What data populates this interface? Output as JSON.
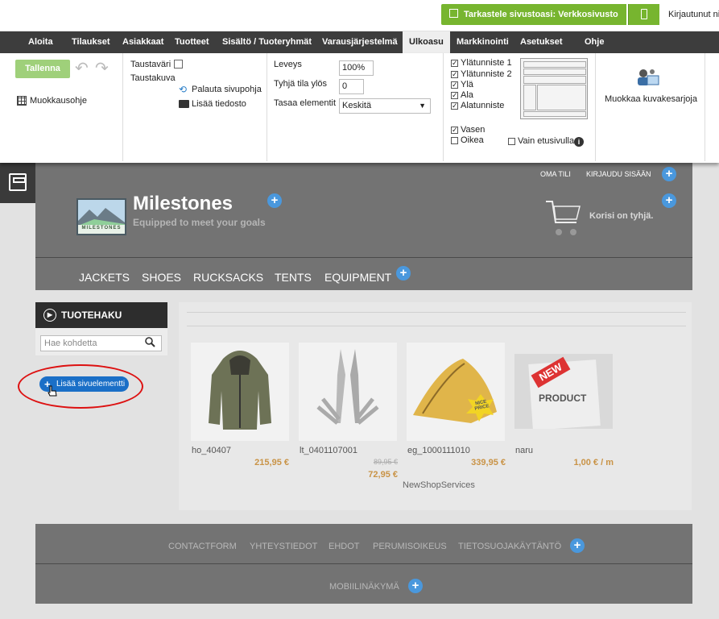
{
  "topbar": {
    "preview_label": "Tarkastele sivustoasi: Verkkosivusto",
    "logged_in_text": "Kirjautunut ni"
  },
  "menu": {
    "items": [
      {
        "label": "Aloita"
      },
      {
        "label": "Tilaukset"
      },
      {
        "label": "Asiakkaat"
      },
      {
        "label": "Tuotteet"
      },
      {
        "label": "Sisältö / Tuoteryhmät"
      },
      {
        "label": "Varausjärjestelmä"
      },
      {
        "label": "Ulkoasu",
        "active": true
      },
      {
        "label": "Markkinointi"
      },
      {
        "label": "Asetukset"
      },
      {
        "label": "Ohje"
      }
    ]
  },
  "ribbon": {
    "save_label": "Tallenna",
    "layout_help_label": "Muokkausohje",
    "bg_color_label": "Taustaväri",
    "bg_image_label": "Taustakuva",
    "restore_template_label": "Palauta sivupohja",
    "add_file_label": "Lisää tiedosto",
    "width_label": "Leveys",
    "width_value": "100%",
    "top_space_label": "Tyhjä tila ylös",
    "top_space_value": "0",
    "align_label": "Tasaa elementit",
    "align_value": "Keskitä",
    "sections": {
      "header1": "Ylätunniste 1",
      "header2": "Ylätunniste 2",
      "top": "Ylä",
      "bottom": "Ala",
      "footer": "Alatunniste",
      "left": "Vasen",
      "right": "Oikea",
      "front_only": "Vain etusivulla"
    },
    "gallery_label": "Muokkaa kuvakesarjoja"
  },
  "site": {
    "top_links": {
      "account": "OMA TILI",
      "login": "KIRJAUDU SISÄÄN"
    },
    "store_name": "Milestones",
    "tagline": "Equipped to meet your goals",
    "logo_text": "MILESTONES",
    "cart_text": "Korisi on tyhjä.",
    "nav": [
      "JACKETS",
      "SHOES",
      "RUCKSACKS",
      "TENTS",
      "EQUIPMENT"
    ]
  },
  "search": {
    "title": "TUOTEHAKU",
    "placeholder": "Hae kohdetta"
  },
  "add_element_label": "Lisää sivuelementti",
  "products": [
    {
      "name": "ho_40407",
      "price": "215,95 €"
    },
    {
      "name": "lt_0401107001",
      "old_price": "89,95 €",
      "price": "72,95 €",
      "extra": "NewShopServices"
    },
    {
      "name": "eg_1000111010",
      "price": "339,95 €",
      "badge": "NICE PRICE"
    },
    {
      "name": "naru",
      "price": "1,00 € / m",
      "image_text": [
        "NEW",
        "PRODUCT"
      ]
    }
  ],
  "footer": {
    "links": [
      "CONTACTFORM",
      "YHTEYSTIEDOT",
      "EHDOT",
      "PERUMISOIKEUS",
      "TIETOSUOJAKÄYTÄNTÖ"
    ],
    "mobile_label": "MOBIILINÄKYMÄ"
  },
  "colors": {
    "accent_green": "#77b52f",
    "plus_blue": "#4a98dd",
    "price_gold": "#c99346",
    "highlight_red": "#dd1111"
  }
}
